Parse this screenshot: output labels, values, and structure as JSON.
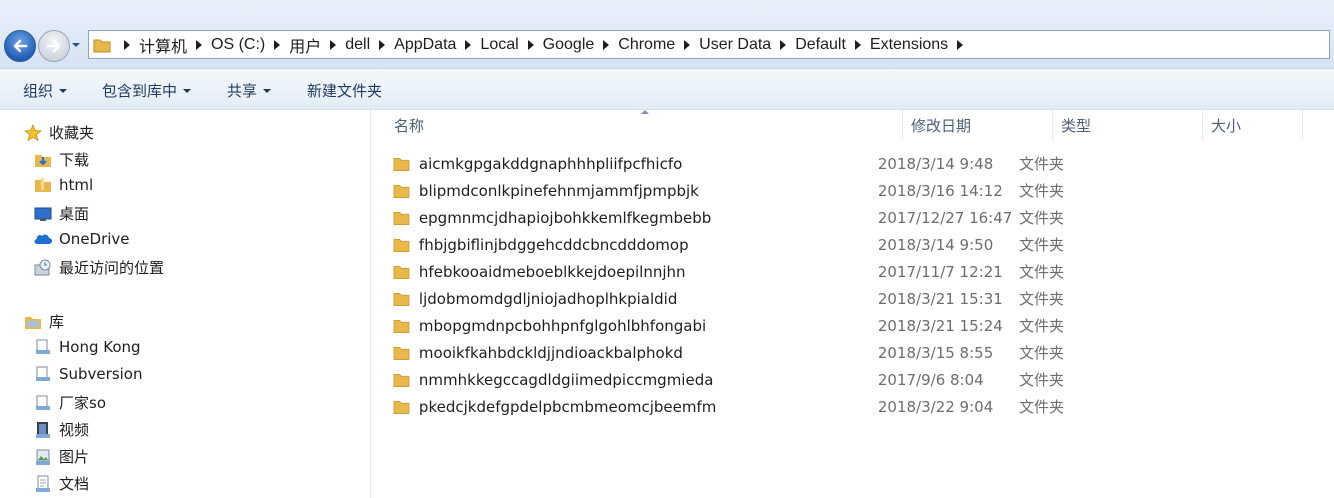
{
  "address": {
    "crumbs": [
      "计算机",
      "OS (C:)",
      "用户",
      "dell",
      "AppData",
      "Local",
      "Google",
      "Chrome",
      "User Data",
      "Default",
      "Extensions"
    ]
  },
  "toolbar": {
    "organize": "组织",
    "include_library": "包含到库中",
    "share": "共享",
    "new_folder": "新建文件夹"
  },
  "nav": {
    "favorites": {
      "label": "收藏夹",
      "items": [
        "下载",
        "html",
        "桌面",
        "OneDrive",
        "最近访问的位置"
      ]
    },
    "libraries": {
      "label": "库",
      "items": [
        "Hong Kong",
        "Subversion",
        "厂家so",
        "视频",
        "图片",
        "文档"
      ]
    }
  },
  "columns": {
    "name": "名称",
    "modified": "修改日期",
    "type": "类型",
    "size": "大小"
  },
  "files": [
    {
      "name": "aicmkgpgakddgnaphhhpliifpcfhicfo",
      "modified": "2018/3/14 9:48",
      "type": "文件夹"
    },
    {
      "name": "blipmdconlkpinefehnmjammfjpmpbjk",
      "modified": "2018/3/16 14:12",
      "type": "文件夹"
    },
    {
      "name": "epgmnmcjdhapiojbohkkemlfkegmbebb",
      "modified": "2017/12/27 16:47",
      "type": "文件夹"
    },
    {
      "name": "fhbjgbiflinjbdggehcddcbncdddomop",
      "modified": "2018/3/14 9:50",
      "type": "文件夹"
    },
    {
      "name": "hfebkooaidmeboeblkkejdoepilnnjhn",
      "modified": "2017/11/7 12:21",
      "type": "文件夹"
    },
    {
      "name": "ljdobmomdgdljniojadhoplhkpialdid",
      "modified": "2018/3/21 15:31",
      "type": "文件夹"
    },
    {
      "name": "mbopgmdnpcbohhpnfglgohlbhfongabi",
      "modified": "2018/3/21 15:24",
      "type": "文件夹"
    },
    {
      "name": "mooikfkahbdckldjjndioackbalphokd",
      "modified": "2018/3/15 8:55",
      "type": "文件夹"
    },
    {
      "name": "nmmhkkegccagdldgiimedpiccmgmieda",
      "modified": "2017/9/6 8:04",
      "type": "文件夹"
    },
    {
      "name": "pkedcjkdefgpdelpbcmbmeomcjbeemfm",
      "modified": "2018/3/22 9:04",
      "type": "文件夹"
    }
  ],
  "colors": {
    "accent": "#1f5fb5",
    "folder": "#e8b94a",
    "toolbar_text": "#1e3a5f"
  }
}
